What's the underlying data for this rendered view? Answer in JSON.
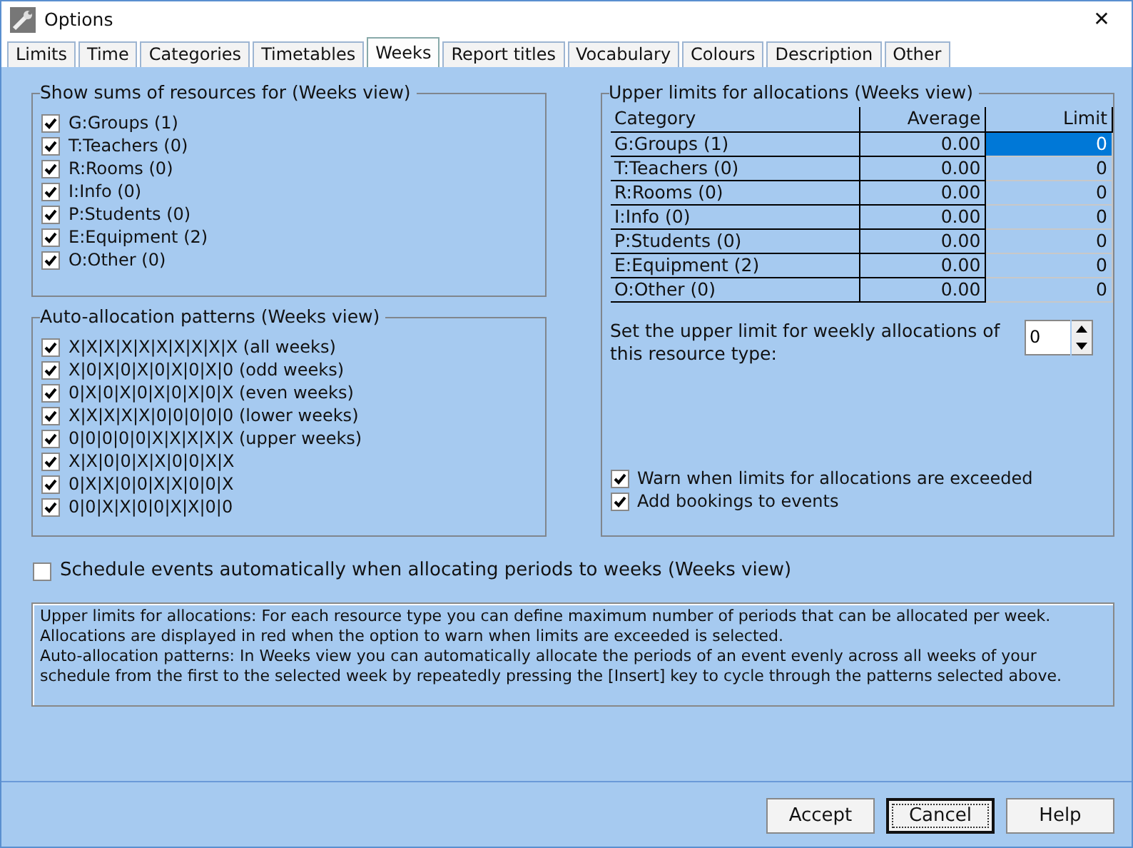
{
  "window": {
    "title": "Options",
    "close": "✕"
  },
  "tabs": [
    {
      "label": "Limits",
      "selected": false
    },
    {
      "label": "Time",
      "selected": false
    },
    {
      "label": "Categories",
      "selected": false
    },
    {
      "label": "Timetables",
      "selected": false
    },
    {
      "label": "Weeks",
      "selected": true
    },
    {
      "label": "Report titles",
      "selected": false
    },
    {
      "label": "Vocabulary",
      "selected": false
    },
    {
      "label": "Colours",
      "selected": false
    },
    {
      "label": "Description",
      "selected": false
    },
    {
      "label": "Other",
      "selected": false
    }
  ],
  "sums_group": {
    "title": "Show sums of resources for (Weeks view)",
    "items": [
      {
        "label": "G:Groups (1)",
        "checked": true
      },
      {
        "label": "T:Teachers (0)",
        "checked": true
      },
      {
        "label": "R:Rooms (0)",
        "checked": true
      },
      {
        "label": "I:Info (0)",
        "checked": true
      },
      {
        "label": "P:Students (0)",
        "checked": true
      },
      {
        "label": "E:Equipment (2)",
        "checked": true
      },
      {
        "label": "O:Other (0)",
        "checked": true
      }
    ]
  },
  "patterns_group": {
    "title": "Auto-allocation patterns (Weeks view)",
    "items": [
      {
        "label": "X|X|X|X|X|X|X|X|X|X (all weeks)",
        "checked": true
      },
      {
        "label": "X|0|X|0|X|0|X|0|X|0 (odd weeks)",
        "checked": true
      },
      {
        "label": "0|X|0|X|0|X|0|X|0|X (even weeks)",
        "checked": true
      },
      {
        "label": "X|X|X|X|X|0|0|0|0|0 (lower weeks)",
        "checked": true
      },
      {
        "label": "0|0|0|0|0|X|X|X|X|X (upper weeks)",
        "checked": true
      },
      {
        "label": "X|X|0|0|X|X|0|0|X|X",
        "checked": true
      },
      {
        "label": "0|X|X|0|0|X|X|0|0|X",
        "checked": true
      },
      {
        "label": "0|0|X|X|0|0|X|X|0|0",
        "checked": true
      }
    ]
  },
  "limits_group": {
    "title": "Upper limits for allocations (Weeks view)",
    "table": {
      "columns": [
        "Category",
        "Average",
        "Limit"
      ],
      "rows": [
        {
          "category": "G:Groups (1)",
          "average": "0.00",
          "limit": "0",
          "selected": true
        },
        {
          "category": "T:Teachers (0)",
          "average": "0.00",
          "limit": "0",
          "selected": false
        },
        {
          "category": "R:Rooms (0)",
          "average": "0.00",
          "limit": "0",
          "selected": false
        },
        {
          "category": "I:Info (0)",
          "average": "0.00",
          "limit": "0",
          "selected": false
        },
        {
          "category": "P:Students (0)",
          "average": "0.00",
          "limit": "0",
          "selected": false
        },
        {
          "category": "E:Equipment (2)",
          "average": "0.00",
          "limit": "0",
          "selected": false
        },
        {
          "category": "O:Other (0)",
          "average": "0.00",
          "limit": "0",
          "selected": false
        }
      ]
    },
    "spinner": {
      "label": "Set the upper limit for weekly allocations of this resource type:",
      "value": "0"
    },
    "options": [
      {
        "label": "Warn when limits for allocations are exceeded",
        "checked": true
      },
      {
        "label": "Add bookings to events",
        "checked": true
      }
    ]
  },
  "schedule_option": {
    "label": "Schedule events automatically when allocating periods to weeks (Weeks view)",
    "checked": false
  },
  "help_text": [
    "Upper limits for allocations: For each resource type you can define maximum number of periods that can be allocated per week. Allocations are displayed in red when the option to warn when limits are exceeded is selected.",
    "Auto-allocation patterns: In Weeks view you can automatically allocate the periods of an event evenly across all weeks of your schedule from the first to the selected week by repeatedly pressing the [Insert] key to cycle through the patterns selected above."
  ],
  "buttons": [
    {
      "label": "Accept",
      "focused": false
    },
    {
      "label": "Cancel",
      "focused": true
    },
    {
      "label": "Help",
      "focused": false
    }
  ]
}
